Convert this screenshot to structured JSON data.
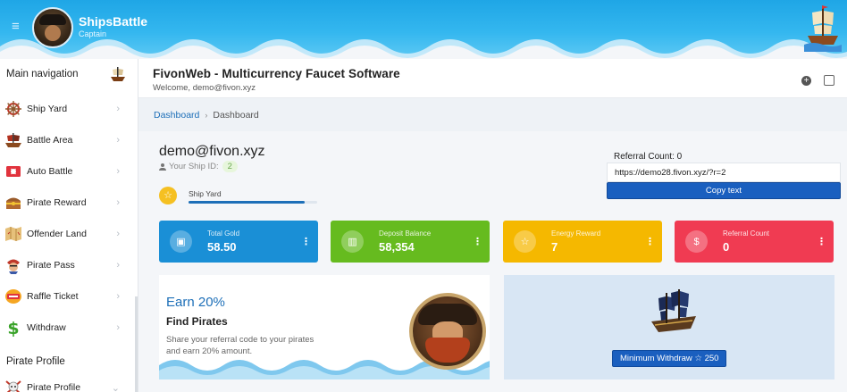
{
  "header": {
    "brand_name": "ShipsBattle",
    "brand_role": "Captain",
    "menu_icon": "hamburger-icon"
  },
  "sidebar": {
    "main_heading": "Main navigation",
    "items": [
      {
        "label": "Ship Yard",
        "icon": "ship-wheel-icon"
      },
      {
        "label": "Battle Area",
        "icon": "battleship-icon"
      },
      {
        "label": "Auto Battle",
        "icon": "flag-icon"
      },
      {
        "label": "Pirate Reward",
        "icon": "treasure-chest-icon"
      },
      {
        "label": "Offender Land",
        "icon": "map-icon"
      },
      {
        "label": "Pirate Pass",
        "icon": "pirate-icon"
      },
      {
        "label": "Raffle Ticket",
        "icon": "ticket-icon"
      },
      {
        "label": "Withdraw",
        "icon": "dollar-icon"
      }
    ],
    "profile_heading": "Pirate Profile",
    "profile_item": {
      "label": "Pirate Profile",
      "icon": "skull-icon"
    }
  },
  "page": {
    "title": "FivonWeb - Multicurrency Faucet Software",
    "welcome": "Welcome, demo@fivon.xyz"
  },
  "breadcrumb": {
    "link": "Dashboard",
    "current": "Dashboard"
  },
  "profile": {
    "email": "demo@fivon.xyz",
    "ship_id_label": "Your Ship ID:",
    "ship_id": "2",
    "level_label": "Ship Yard",
    "level_progress": 0.9
  },
  "referral": {
    "count_label": "Referral Count: 0",
    "link": "https://demo28.fivon.xyz/?r=2",
    "copy_label": "Copy text"
  },
  "stats": [
    {
      "label": "Total Gold",
      "value": "58.50",
      "color": "#1a8fd6"
    },
    {
      "label": "Deposit Balance",
      "value": "58,354",
      "color": "#66bb1f"
    },
    {
      "label": "Energy Reward",
      "value": "7",
      "color": "#f5b800"
    },
    {
      "label": "Referral Count",
      "value": "0",
      "color": "#f03b52"
    }
  ],
  "earn": {
    "title": "Earn 20%",
    "subtitle": "Find Pirates",
    "description": "Share your referral code to your pirates and earn 20% amount."
  },
  "withdraw": {
    "label": "Minimum Withdraw",
    "amount": "250"
  },
  "colors": {
    "accent": "#1d6fb8",
    "header": "#1fa6e6",
    "button": "#1a5fbf"
  }
}
